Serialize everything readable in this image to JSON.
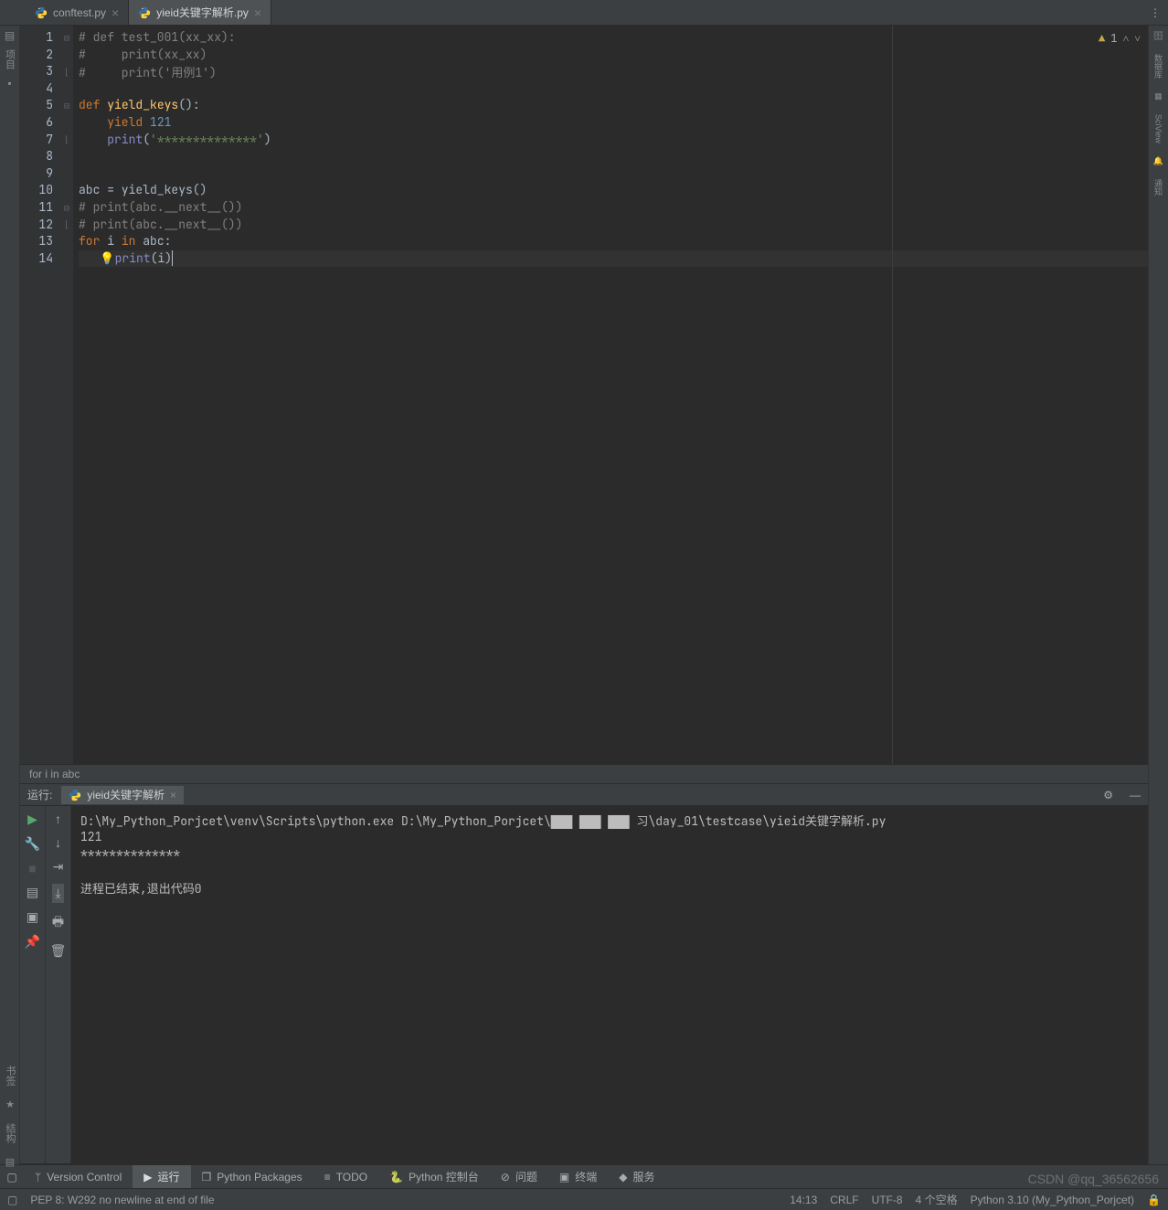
{
  "tabs": [
    {
      "label": "conftest.py",
      "active": false
    },
    {
      "label": "yieid关键字解析.py",
      "active": true
    }
  ],
  "code": {
    "lines": [
      {
        "n": 1,
        "fold": "⊟",
        "html": "<span class='cmt'># def test_001(xx_xx):</span>"
      },
      {
        "n": 2,
        "fold": "",
        "html": "<span class='cmt'>#     print(xx_xx)</span>"
      },
      {
        "n": 3,
        "fold": "⌊",
        "html": "<span class='cmt'>#     print('用例1')</span>"
      },
      {
        "n": 4,
        "fold": "",
        "html": ""
      },
      {
        "n": 5,
        "fold": "⊟",
        "html": "<span class='kw'>def</span> <span class='fn'>yield_keys</span>():"
      },
      {
        "n": 6,
        "fold": "",
        "html": "    <span class='kw'>yield</span> <span class='num'>121</span>"
      },
      {
        "n": 7,
        "fold": "⌊",
        "html": "    <span class='builtin'>print</span>(<span class='str'>'**************'</span>)"
      },
      {
        "n": 8,
        "fold": "",
        "html": ""
      },
      {
        "n": 9,
        "fold": "",
        "html": ""
      },
      {
        "n": 10,
        "fold": "",
        "html": "abc = yield_keys()"
      },
      {
        "n": 11,
        "fold": "⊟",
        "html": "<span class='cmt'># print(abc.__next__())</span>"
      },
      {
        "n": 12,
        "fold": "⌊",
        "html": "<span class='cmt'># print(abc.__next__())</span>"
      },
      {
        "n": 13,
        "fold": "",
        "html": "<span class='kw'>for</span> i <span class='kw'>in</span> abc:"
      },
      {
        "n": 14,
        "fold": "",
        "html": "   <span class='bulb'>💡</span><span class='builtin'>print</span>(i)<span class='caret'></span>",
        "active": true
      }
    ],
    "inspect_warn": "1"
  },
  "breadcrumb": "for i in abc",
  "run": {
    "label": "运行:",
    "tab": "yieid关键字解析",
    "output": [
      "D:\\My_Python_Porjcet\\venv\\Scripts\\python.exe D:\\My_Python_Porjcet\\▇▇▇ ▇▇▇ ▇▇▇ 习\\day_01\\testcase\\yieid关键字解析.py",
      "121",
      "**************",
      "",
      "进程已结束,退出代码0"
    ]
  },
  "left_strip": {
    "bookmark": "书签",
    "structure": "结构"
  },
  "right_strip": {
    "db": "数据库",
    "sci": "SciView",
    "notif": "通知"
  },
  "bottom_tools": {
    "version_control": "Version Control",
    "run": "运行",
    "python_packages": "Python Packages",
    "todo": "TODO",
    "python_console": "Python 控制台",
    "problems": "问题",
    "terminal": "终端",
    "services": "服务"
  },
  "status": {
    "msg": "PEP 8: W292 no newline at end of file",
    "pos": "14:13",
    "sep": "CRLF",
    "enc": "UTF-8",
    "indent": "4 个空格",
    "interp": "Python 3.10 (My_Python_Porjcet)"
  },
  "watermark": "CSDN @qq_36562656"
}
